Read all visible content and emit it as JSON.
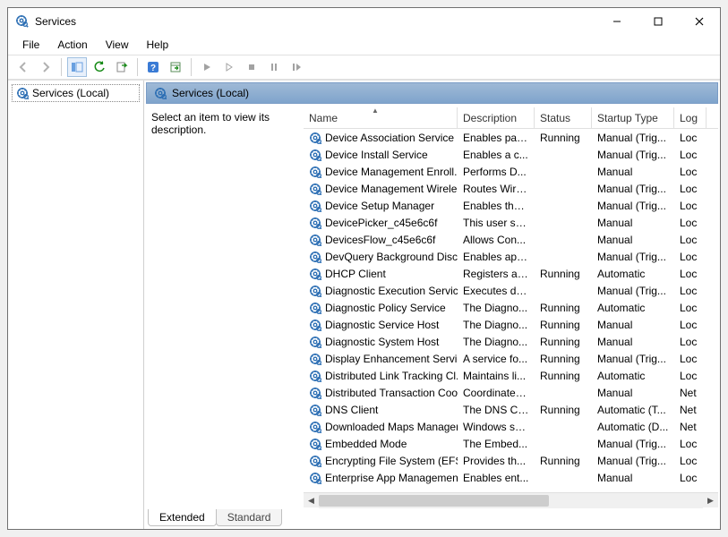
{
  "window": {
    "title": "Services"
  },
  "menu": {
    "file": "File",
    "action": "Action",
    "view": "View",
    "help": "Help"
  },
  "nav": {
    "root": "Services (Local)"
  },
  "pane": {
    "title": "Services (Local)",
    "hint": "Select an item to view its description."
  },
  "columns": {
    "name": "Name",
    "description": "Description",
    "status": "Status",
    "startup": "Startup Type",
    "logon": "Log"
  },
  "tabs": {
    "extended": "Extended",
    "standard": "Standard"
  },
  "services": [
    {
      "name": "Device Association Service",
      "desc": "Enables pair...",
      "status": "Running",
      "startup": "Manual (Trig...",
      "log": "Loc"
    },
    {
      "name": "Device Install Service",
      "desc": "Enables a c...",
      "status": "",
      "startup": "Manual (Trig...",
      "log": "Loc"
    },
    {
      "name": "Device Management Enroll...",
      "desc": "Performs D...",
      "status": "",
      "startup": "Manual",
      "log": "Loc"
    },
    {
      "name": "Device Management Wirele...",
      "desc": "Routes Wire...",
      "status": "",
      "startup": "Manual (Trig...",
      "log": "Loc"
    },
    {
      "name": "Device Setup Manager",
      "desc": "Enables the ...",
      "status": "",
      "startup": "Manual (Trig...",
      "log": "Loc"
    },
    {
      "name": "DevicePicker_c45e6c6f",
      "desc": "This user se...",
      "status": "",
      "startup": "Manual",
      "log": "Loc"
    },
    {
      "name": "DevicesFlow_c45e6c6f",
      "desc": "Allows Con...",
      "status": "",
      "startup": "Manual",
      "log": "Loc"
    },
    {
      "name": "DevQuery Background Disc...",
      "desc": "Enables app...",
      "status": "",
      "startup": "Manual (Trig...",
      "log": "Loc"
    },
    {
      "name": "DHCP Client",
      "desc": "Registers an...",
      "status": "Running",
      "startup": "Automatic",
      "log": "Loc"
    },
    {
      "name": "Diagnostic Execution Service",
      "desc": "Executes dia...",
      "status": "",
      "startup": "Manual (Trig...",
      "log": "Loc"
    },
    {
      "name": "Diagnostic Policy Service",
      "desc": "The Diagno...",
      "status": "Running",
      "startup": "Automatic",
      "log": "Loc"
    },
    {
      "name": "Diagnostic Service Host",
      "desc": "The Diagno...",
      "status": "Running",
      "startup": "Manual",
      "log": "Loc"
    },
    {
      "name": "Diagnostic System Host",
      "desc": "The Diagno...",
      "status": "Running",
      "startup": "Manual",
      "log": "Loc"
    },
    {
      "name": "Display Enhancement Service",
      "desc": "A service fo...",
      "status": "Running",
      "startup": "Manual (Trig...",
      "log": "Loc"
    },
    {
      "name": "Distributed Link Tracking Cl...",
      "desc": "Maintains li...",
      "status": "Running",
      "startup": "Automatic",
      "log": "Loc"
    },
    {
      "name": "Distributed Transaction Coo...",
      "desc": "Coordinates...",
      "status": "",
      "startup": "Manual",
      "log": "Net"
    },
    {
      "name": "DNS Client",
      "desc": "The DNS Cli...",
      "status": "Running",
      "startup": "Automatic (T...",
      "log": "Net"
    },
    {
      "name": "Downloaded Maps Manager",
      "desc": "Windows se...",
      "status": "",
      "startup": "Automatic (D...",
      "log": "Net"
    },
    {
      "name": "Embedded Mode",
      "desc": "The Embed...",
      "status": "",
      "startup": "Manual (Trig...",
      "log": "Loc"
    },
    {
      "name": "Encrypting File System (EFS)",
      "desc": "Provides th...",
      "status": "Running",
      "startup": "Manual (Trig...",
      "log": "Loc"
    },
    {
      "name": "Enterprise App Managemen...",
      "desc": "Enables ent...",
      "status": "",
      "startup": "Manual",
      "log": "Loc"
    }
  ]
}
